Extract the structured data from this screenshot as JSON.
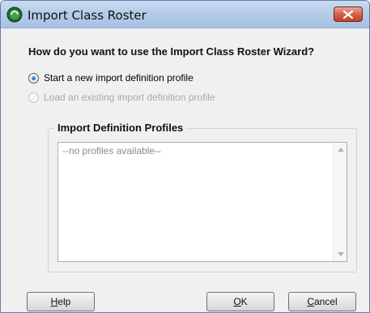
{
  "window": {
    "title": "Import Class Roster",
    "icon": "roster-app-icon"
  },
  "wizard": {
    "question": "How do you want to use the Import Class Roster Wizard?",
    "options": [
      {
        "label": "Start a new import definition profile",
        "checked": true,
        "enabled": true
      },
      {
        "label": "Load an existing import definition profile",
        "checked": false,
        "enabled": false
      }
    ]
  },
  "profiles": {
    "legend": "Import Definition Profiles",
    "empty_text": "--no profiles available--"
  },
  "buttons": {
    "help": {
      "mnemonic": "H",
      "rest": "elp"
    },
    "ok": {
      "mnemonic": "O",
      "rest": "K"
    },
    "cancel": {
      "mnemonic": "C",
      "rest": "ancel"
    }
  },
  "colors": {
    "close_button": "#d6604a",
    "radio_selected": "#1f5fbf",
    "disabled_text": "#a9a9a9"
  }
}
